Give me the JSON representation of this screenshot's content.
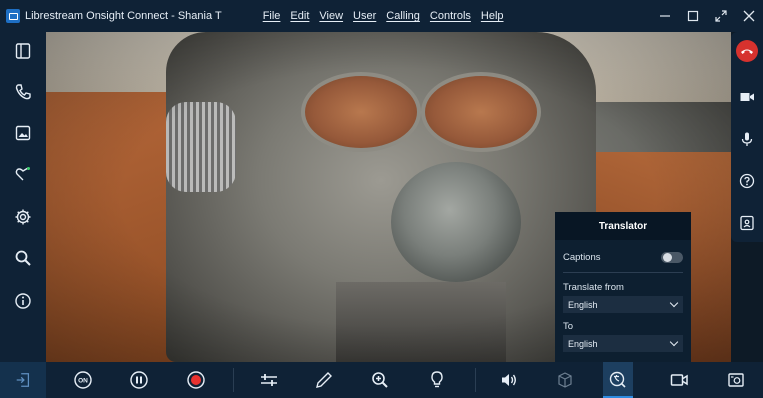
{
  "window": {
    "title": "Librestream Onsight Connect - Shania T",
    "menu": [
      "File",
      "Edit",
      "View",
      "User",
      "Calling",
      "Controls",
      "Help"
    ],
    "controls": [
      "minimize-icon",
      "maximize-icon",
      "expand-icon",
      "close-icon"
    ]
  },
  "sidebar_left": {
    "items": [
      {
        "name": "side-panel-icon"
      },
      {
        "name": "phone-icon"
      },
      {
        "name": "gallery-icon"
      },
      {
        "name": "favorites-icon"
      },
      {
        "name": "settings-gear-icon"
      },
      {
        "name": "search-icon"
      },
      {
        "name": "info-icon"
      }
    ]
  },
  "sidebar_right": {
    "items": [
      {
        "name": "hang-up-icon",
        "color": "#d6322e"
      },
      {
        "name": "video-camera-icon"
      },
      {
        "name": "microphone-icon"
      },
      {
        "name": "help-icon"
      },
      {
        "name": "contact-card-icon"
      }
    ]
  },
  "translator": {
    "title": "Translator",
    "captions_label": "Captions",
    "captions_on": false,
    "translate_from_label": "Translate from",
    "translate_from_value": "English",
    "to_label": "To",
    "to_value": "English"
  },
  "toolbar": {
    "on_label": "ON",
    "items": [
      "exit-icon",
      "on-toggle-icon",
      "pause-icon",
      "record-icon",
      "adjust-sliders-icon",
      "pen-icon",
      "zoom-in-icon",
      "lightbulb-icon",
      "volume-icon",
      "cube-icon",
      "translator-icon",
      "video-icon",
      "snapshot-icon"
    ],
    "record_color": "#e8322f",
    "active_tool": "translator-icon"
  }
}
